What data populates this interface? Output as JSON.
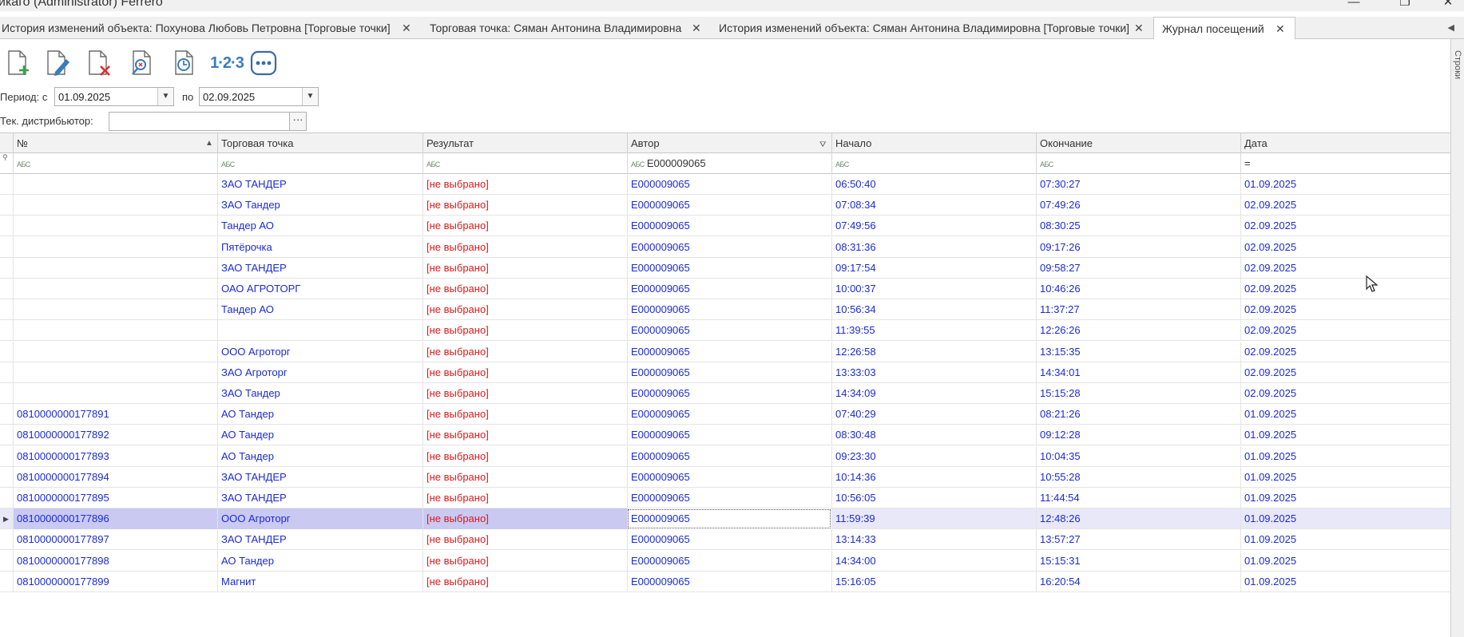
{
  "window": {
    "title": "икаго (Administrator) Ferrero",
    "minimize": "—",
    "restore": "❐",
    "close": "✕"
  },
  "tabs": [
    {
      "label": "История изменений объекта: Похунова Любовь Петровна [Торговые точки]",
      "active": false
    },
    {
      "label": "Торговая точка:  Сяман Антонина Владимировна",
      "active": false
    },
    {
      "label": "История изменений объекта: Сяман Антонина Владимировна [Торговые точки]",
      "active": false
    },
    {
      "label": "Журнал посещений",
      "active": true
    }
  ],
  "tab_close": "✕",
  "tab_scroll": "◀",
  "side_panel": {
    "label": "Строки"
  },
  "toolbar": {
    "buttons": [
      "add-icon",
      "edit-icon",
      "delete-icon",
      "find-icon",
      "history-icon",
      "numbering-icon",
      "more-icon"
    ],
    "numbering_label": "1·2·3"
  },
  "filters": {
    "period_from_label": "Период: с",
    "period_from_value": "01.09.2025",
    "period_to_label": "по",
    "period_to_value": "02.09.2025",
    "distributor_label": "Тек. дистрибьютор:",
    "distributor_value": "",
    "distributor_button": "···",
    "dropdown_arrow": "▼"
  },
  "grid": {
    "columns": [
      "№",
      "Торговая точка",
      "Результат",
      "Автор",
      "Начало",
      "Окончание",
      "Дата"
    ],
    "filter_row": {
      "abc": "АБС",
      "author_filter": "E000009065",
      "date_filter": "="
    },
    "rows": [
      {
        "num": "",
        "shop": "ЗАО ТАНДЕР",
        "result": "[не выбрано]",
        "author": "E000009065",
        "start": "06:50:40",
        "end": "07:30:27",
        "date": "01.09.2025"
      },
      {
        "num": "",
        "shop": "ЗАО Тандер",
        "result": "[не выбрано]",
        "author": "E000009065",
        "start": "07:08:34",
        "end": "07:49:26",
        "date": "02.09.2025"
      },
      {
        "num": "",
        "shop": "Тандер АО",
        "result": "[не выбрано]",
        "author": "E000009065",
        "start": "07:49:56",
        "end": "08:30:25",
        "date": "02.09.2025"
      },
      {
        "num": "",
        "shop": "Пятёрочка",
        "result": "[не выбрано]",
        "author": "E000009065",
        "start": "08:31:36",
        "end": "09:17:26",
        "date": "02.09.2025"
      },
      {
        "num": "",
        "shop": "ЗАО ТАНДЕР",
        "result": "[не выбрано]",
        "author": "E000009065",
        "start": "09:17:54",
        "end": "09:58:27",
        "date": "02.09.2025"
      },
      {
        "num": "",
        "shop": "ОАО АГРОТОРГ",
        "result": "[не выбрано]",
        "author": "E000009065",
        "start": "10:00:37",
        "end": "10:46:26",
        "date": "02.09.2025"
      },
      {
        "num": "",
        "shop": "Тандер АО",
        "result": "[не выбрано]",
        "author": "E000009065",
        "start": "10:56:34",
        "end": "11:37:27",
        "date": "02.09.2025"
      },
      {
        "num": "",
        "shop": "",
        "result": "[не выбрано]",
        "author": "E000009065",
        "start": "11:39:55",
        "end": "12:26:26",
        "date": "02.09.2025"
      },
      {
        "num": "",
        "shop": "ООО Агроторг",
        "result": "[не выбрано]",
        "author": "E000009065",
        "start": "12:26:58",
        "end": "13:15:35",
        "date": "02.09.2025"
      },
      {
        "num": "",
        "shop": "ЗАО Агроторг",
        "result": "[не выбрано]",
        "author": "E000009065",
        "start": "13:33:03",
        "end": "14:34:01",
        "date": "02.09.2025"
      },
      {
        "num": "",
        "shop": "ЗАО Тандер",
        "result": "[не выбрано]",
        "author": "E000009065",
        "start": "14:34:09",
        "end": "15:15:28",
        "date": "02.09.2025"
      },
      {
        "num": "0810000000177891",
        "shop": "АО Тандер",
        "result": "[не выбрано]",
        "author": "E000009065",
        "start": "07:40:29",
        "end": "08:21:26",
        "date": "01.09.2025"
      },
      {
        "num": "0810000000177892",
        "shop": "АО Тандер",
        "result": "[не выбрано]",
        "author": "E000009065",
        "start": "08:30:48",
        "end": "09:12:28",
        "date": "01.09.2025"
      },
      {
        "num": "0810000000177893",
        "shop": "АО Тандер",
        "result": "[не выбрано]",
        "author": "E000009065",
        "start": "09:23:30",
        "end": "10:04:35",
        "date": "01.09.2025"
      },
      {
        "num": "0810000000177894",
        "shop": "ЗАО ТАНДЕР",
        "result": "[не выбрано]",
        "author": "E000009065",
        "start": "10:14:36",
        "end": "10:55:28",
        "date": "01.09.2025"
      },
      {
        "num": "0810000000177895",
        "shop": "ЗАО ТАНДЕР",
        "result": "[не выбрано]",
        "author": "E000009065",
        "start": "10:56:05",
        "end": "11:44:54",
        "date": "01.09.2025"
      },
      {
        "num": "0810000000177896",
        "shop": "ООО Агроторг",
        "result": "[не выбрано]",
        "author": "E000009065",
        "start": "11:59:39",
        "end": "12:48:26",
        "date": "01.09.2025",
        "selected": true
      },
      {
        "num": "0810000000177897",
        "shop": "ЗАО ТАНДЕР",
        "result": "[не выбрано]",
        "author": "E000009065",
        "start": "13:14:33",
        "end": "13:57:27",
        "date": "01.09.2025"
      },
      {
        "num": "0810000000177898",
        "shop": "АО Тандер",
        "result": "[не выбрано]",
        "author": "E000009065",
        "start": "14:34:00",
        "end": "15:15:31",
        "date": "01.09.2025"
      },
      {
        "num": "0810000000177899",
        "shop": "Магнит",
        "result": "[не выбрано]",
        "author": "E000009065",
        "start": "15:16:05",
        "end": "16:20:54",
        "date": "01.09.2025"
      }
    ]
  },
  "colors": {
    "link_text": "#1a2bd6",
    "result_text": "#e01818",
    "selected_row": "#c9c9f2",
    "icon_blue": "#3a7bbf",
    "icon_red": "#e03030",
    "icon_green": "#3aa04a"
  }
}
